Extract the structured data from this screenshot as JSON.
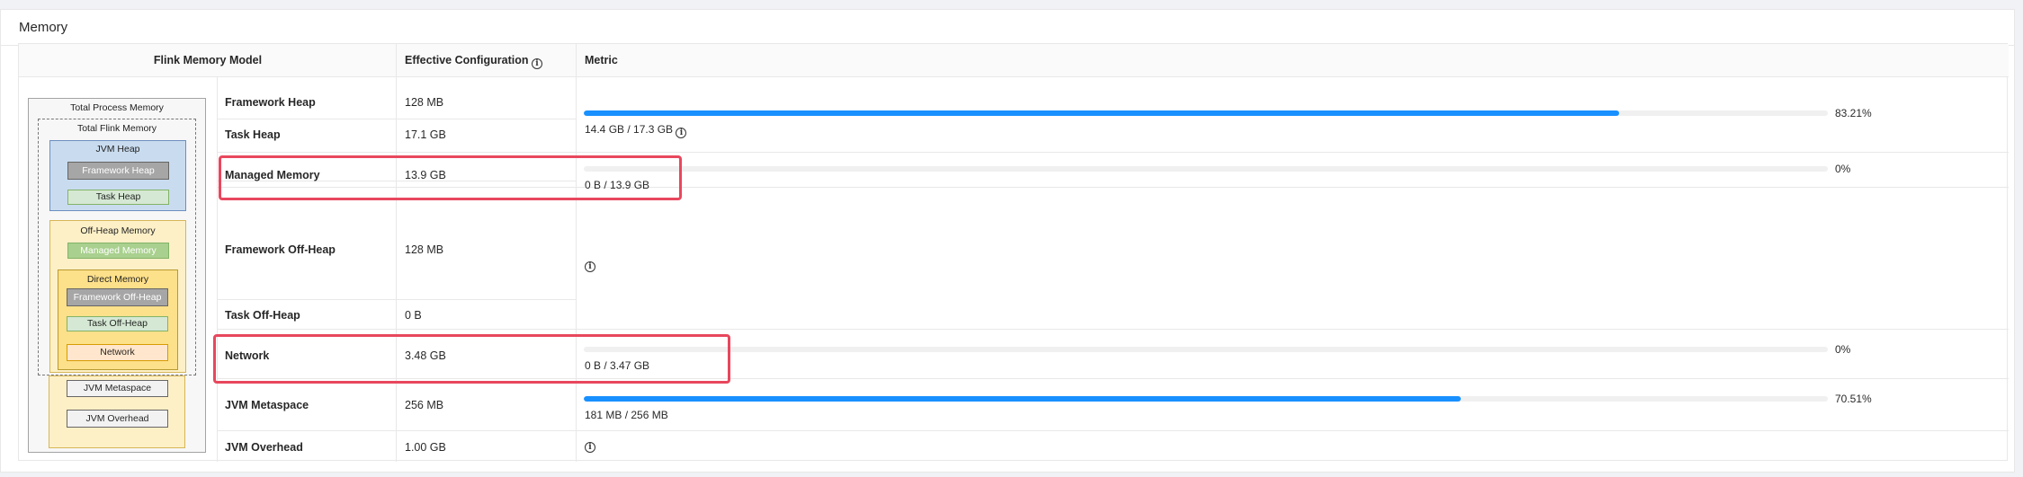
{
  "card": {
    "title": "Memory"
  },
  "columns": {
    "model": "Flink Memory Model",
    "config": "Effective Configuration",
    "metric": "Metric"
  },
  "diagram": {
    "total_process": "Total Process Memory",
    "total_flink": "Total Flink Memory",
    "jvm_heap": "JVM Heap",
    "framework_heap": "Framework Heap",
    "task_heap": "Task Heap",
    "off_heap": "Off-Heap Memory",
    "managed": "Managed Memory",
    "direct": "Direct Memory",
    "framework_off_heap": "Framework Off-Heap",
    "task_off_heap": "Task Off-Heap",
    "network": "Network",
    "jvm_metaspace": "JVM Metaspace",
    "jvm_overhead": "JVM Overhead"
  },
  "rows": [
    {
      "name": "Framework Heap",
      "value": "128 MB"
    },
    {
      "name": "Task Heap",
      "value": "17.1 GB"
    },
    {
      "name": "Managed Memory",
      "value": "13.9 GB"
    },
    {
      "name": "Framework Off-Heap",
      "value": "128 MB"
    },
    {
      "name": "Task Off-Heap",
      "value": "0 B"
    },
    {
      "name": "Network",
      "value": "3.48 GB"
    },
    {
      "name": "JVM Metaspace",
      "value": "256 MB"
    },
    {
      "name": "JVM Overhead",
      "value": "1.00 GB"
    }
  ],
  "metrics": {
    "heap": {
      "usage": "14.4 GB / 17.3 GB",
      "percent": "83.21%",
      "fraction": 0.8321
    },
    "managed": {
      "usage": "0 B / 13.9 GB",
      "percent": "0%",
      "fraction": 0
    },
    "network": {
      "usage": "0 B / 3.47 GB",
      "percent": "0%",
      "fraction": 0
    },
    "metaspace": {
      "usage": "181 MB / 256 MB",
      "percent": "70.51%",
      "fraction": 0.7051
    }
  },
  "colors": {
    "progress": "#1890ff",
    "highlight": "#e8475d",
    "jvm_heap_bg": "#c9dcef",
    "off_heap_bg": "#fdf0c7",
    "direct_bg": "#fde08a",
    "grey_box": "#a6a6a6",
    "green_box": "#d5e8d4",
    "orange_box": "#ffe6cc"
  }
}
